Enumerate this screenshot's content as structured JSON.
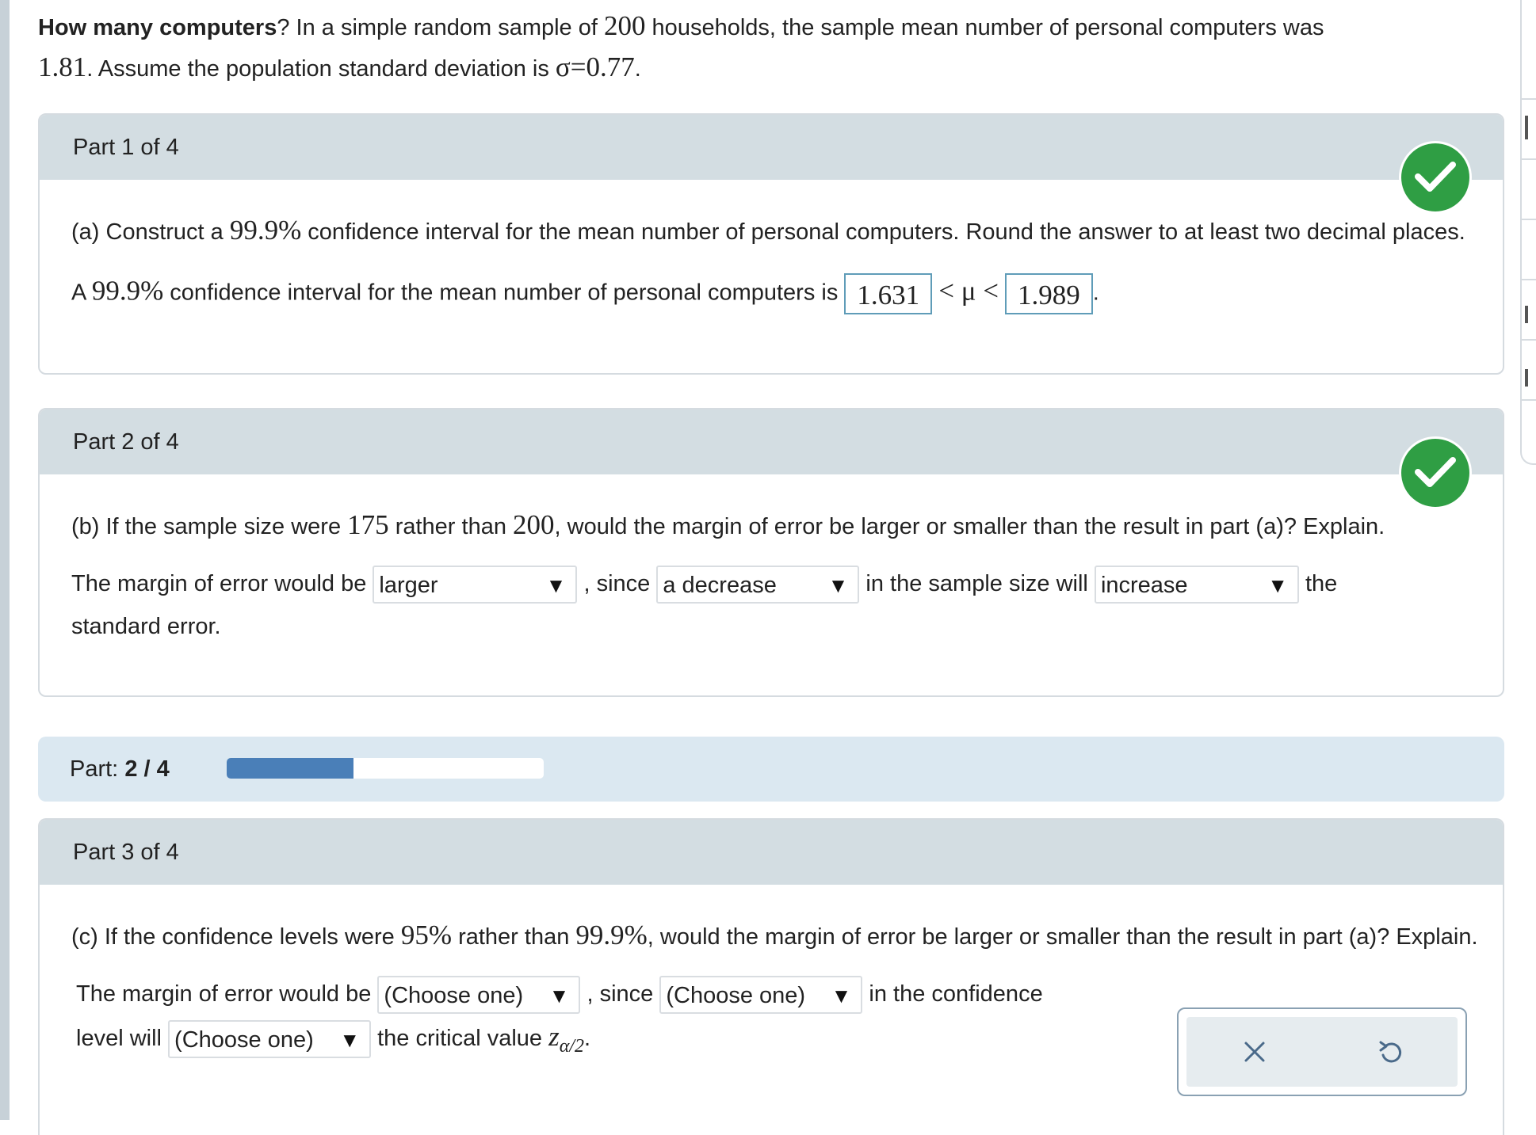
{
  "intro": {
    "title": "How many computers",
    "t1": "? In a simple random sample of ",
    "n": "200",
    "t2": " households, the sample mean number of personal computers was ",
    "mean": "1.81",
    "t3": ". Assume the population standard deviation is ",
    "sigma": "σ=0.77",
    "t4": "."
  },
  "part1": {
    "header": "Part 1 of 4",
    "q_pre": "(a) Construct a ",
    "q_conf": "99.9%",
    "q_post": " confidence interval for the mean number of personal computers. Round the answer to at least two decimal places.",
    "ans_pre": "A ",
    "ans_conf": "99.9%",
    "ans_mid": " confidence interval for the mean number of personal computers is",
    "lower": "1.631",
    "mu": "< μ <",
    "upper": "1.989",
    "period": "."
  },
  "part2": {
    "header": "Part 2 of 4",
    "q_pre": "(b) If the sample size were ",
    "n_new": "175",
    "q_mid": " rather than ",
    "n_old": "200",
    "q_post": ", would the margin of error be larger or smaller than the result in part (a)? Explain.",
    "s1": "The margin of error would be",
    "d1": "larger",
    "s2": ", since",
    "d2": "a decrease",
    "s3": "in the sample size will",
    "d3": "increase",
    "s4": "the",
    "s5": "standard error."
  },
  "progress": {
    "label": "Part:",
    "value": "2 / 4",
    "fraction": 0.4
  },
  "part3": {
    "header": "Part 3 of 4",
    "q_pre": "(c) If the confidence levels were ",
    "c_new": "95%",
    "q_mid": " rather than ",
    "c_old": "99.9%",
    "q_post": ", would the margin of error be larger or smaller than the result in part (a)? Explain.",
    "s1": "The margin of error would be",
    "d1": "(Choose one)",
    "s2": ", since",
    "d2": "(Choose one)",
    "s3": "in the confidence",
    "s4": "level will",
    "d3": "(Choose one)",
    "s5": "the critical value",
    "z": "z",
    "sub": "α/2",
    "period": "."
  },
  "icons": {
    "check": "check-icon",
    "clear": "close-icon",
    "undo": "undo-icon",
    "dropdown": "triangle-down-icon"
  },
  "colors": {
    "check_green": "#2f9e44",
    "header_gray": "#d3dde2",
    "progress_bg": "#dbe8f1",
    "progress_fill": "#4a7fb8"
  }
}
